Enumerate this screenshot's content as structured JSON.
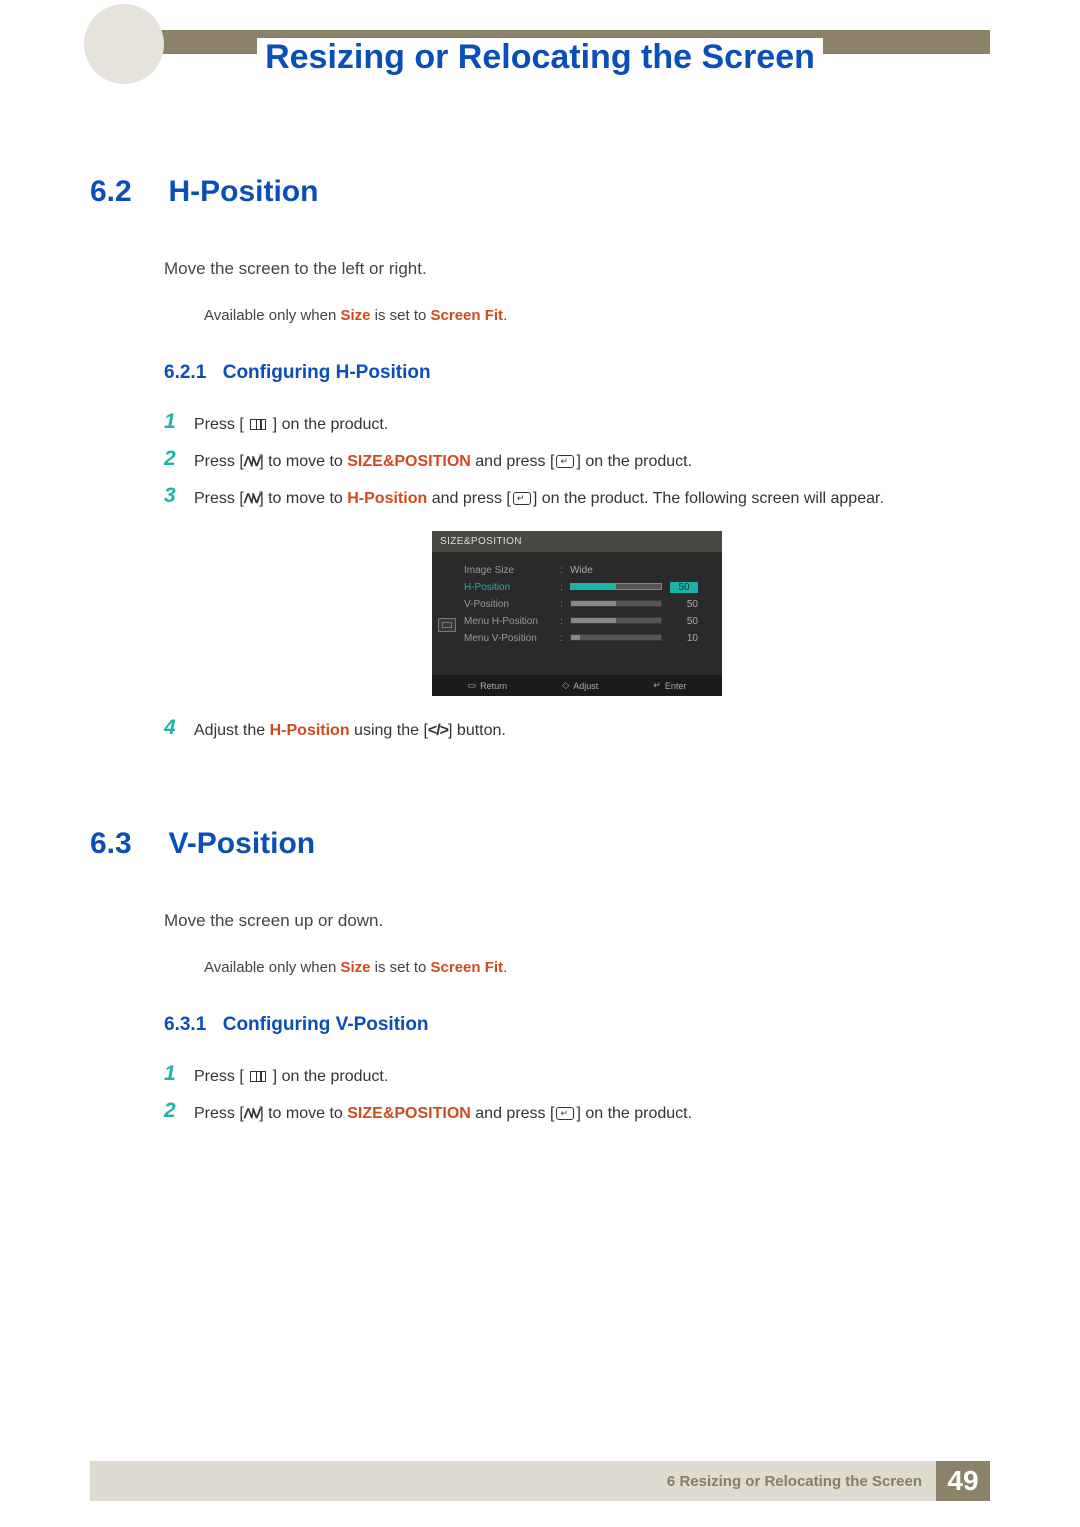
{
  "chapter_title": "Resizing or Relocating the Screen",
  "section62": {
    "num": "6.2",
    "title": "H-Position",
    "desc": "Move the screen to the left or right.",
    "note_pre": "Available only when ",
    "note_kw1": "Size",
    "note_mid": " is set to ",
    "note_kw2": "Screen Fit",
    "note_post": ".",
    "sub_num": "6.2.1",
    "sub_title": "Configuring H-Position",
    "steps": {
      "s1_pre": "Press [ ",
      "s1_post": " ] on the product.",
      "s2_pre": "Press [",
      "s2_mid1": "] to move to ",
      "s2_kw": "SIZE&POSITION",
      "s2_mid2": " and press [",
      "s2_post": "] on the product.",
      "s3_pre": "Press [",
      "s3_mid1": "] to move to ",
      "s3_kw": "H-Position",
      "s3_mid2": " and press [",
      "s3_post": "] on the product. The following screen will appear.",
      "s4_pre": "Adjust the ",
      "s4_kw": "H-Position",
      "s4_mid": " using the [",
      "s4_post": "] button."
    }
  },
  "section63": {
    "num": "6.3",
    "title": "V-Position",
    "desc": "Move the screen up or down.",
    "note_pre": "Available only when ",
    "note_kw1": "Size",
    "note_mid": " is set to ",
    "note_kw2": "Screen Fit",
    "note_post": ".",
    "sub_num": "6.3.1",
    "sub_title": "Configuring V-Position",
    "steps": {
      "s1_pre": "Press [ ",
      "s1_post": " ] on the product.",
      "s2_pre": "Press [",
      "s2_mid1": "] to move to ",
      "s2_kw": "SIZE&POSITION",
      "s2_mid2": " and press [",
      "s2_post": "] on the product."
    }
  },
  "osd": {
    "title": "SIZE&POSITION",
    "rows": {
      "image_size": {
        "label": "Image Size",
        "value": "Wide"
      },
      "h_position": {
        "label": "H-Position",
        "value": "50",
        "fill": 50
      },
      "v_position": {
        "label": "V-Position",
        "value": "50",
        "fill": 50
      },
      "menu_h": {
        "label": "Menu H-Position",
        "value": "50",
        "fill": 50
      },
      "menu_v": {
        "label": "Menu V-Position",
        "value": "10",
        "fill": 10
      }
    },
    "footer": {
      "return": "Return",
      "adjust": "Adjust",
      "enter": "Enter"
    }
  },
  "footer": {
    "chapter_num": "6",
    "chapter_text": "Resizing or Relocating the Screen",
    "page": "49"
  }
}
